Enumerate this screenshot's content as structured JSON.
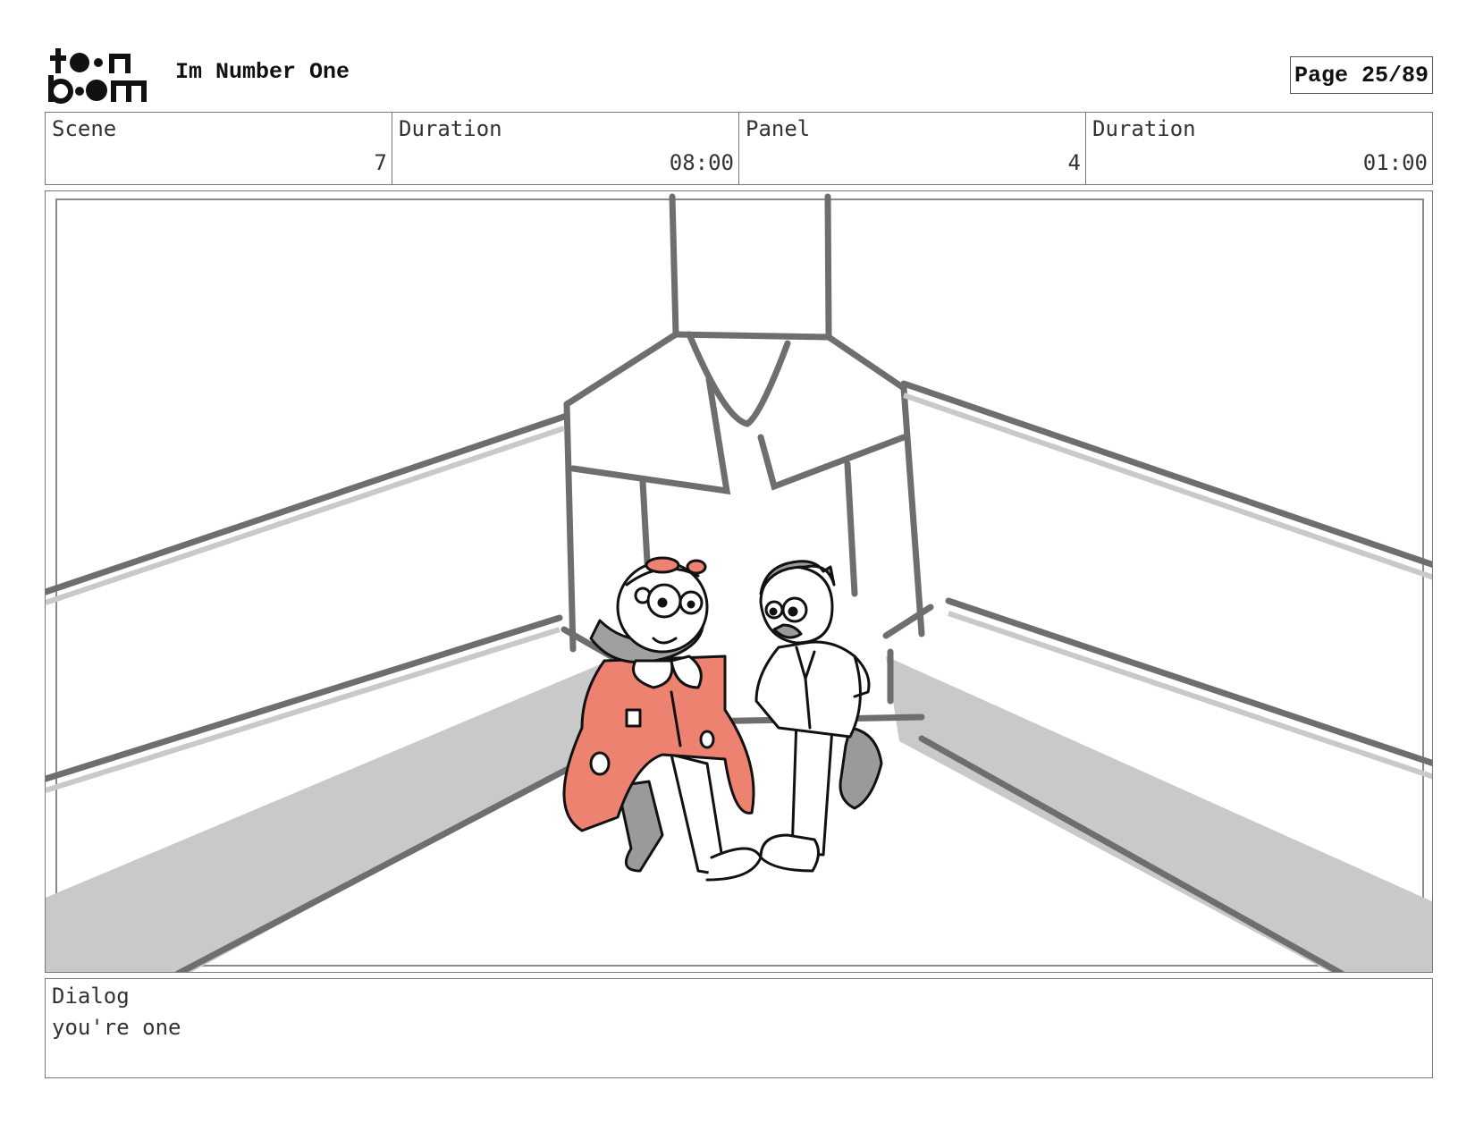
{
  "header": {
    "logo_text_top": "toon",
    "logo_text_bottom": "boom",
    "title": "Im Number One",
    "page_label": "Page 25/89"
  },
  "info": [
    {
      "label": "Scene",
      "value": "7"
    },
    {
      "label": "Duration",
      "value": "08:00"
    },
    {
      "label": "Panel",
      "value": "4"
    },
    {
      "label": "Duration",
      "value": "01:00"
    }
  ],
  "panel": {
    "icon": "storyboard-sketch-image",
    "colors": {
      "line": "#6e6e6e",
      "shadow": "#c9c9c9",
      "coat": "#ee8270",
      "ink": "#111111"
    }
  },
  "dialog": {
    "label": "Dialog",
    "text": "you're one"
  }
}
